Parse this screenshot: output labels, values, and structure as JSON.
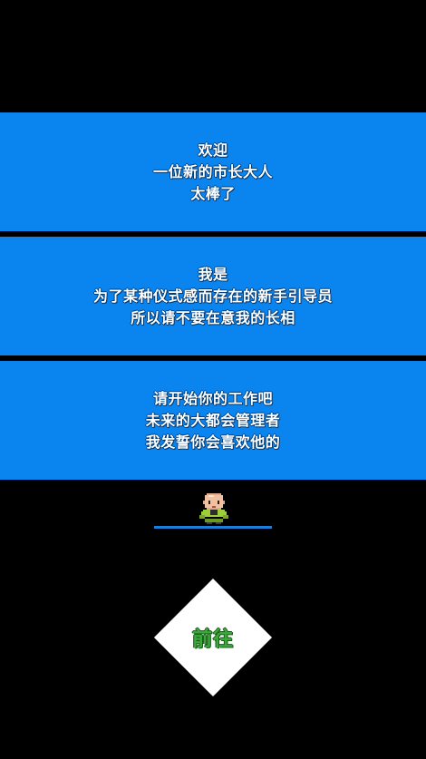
{
  "dialog": {
    "panels": [
      {
        "lines": [
          "欢迎",
          "一位新的市长大人",
          "太棒了"
        ]
      },
      {
        "lines": [
          "我是",
          "为了某种仪式感而存在的新手引导员",
          "所以请不要在意我的长相"
        ]
      },
      {
        "lines": [
          "请开始你的工作吧",
          "未来的大都会管理者",
          "我发誓你会喜欢他的"
        ]
      }
    ]
  },
  "guide": {
    "sprite_icon": "pixel-bald-guide-character"
  },
  "go_button": {
    "label": "前往"
  },
  "colors": {
    "background": "#000000",
    "panel": "#0a85f0",
    "text": "#ffffff",
    "button_fill": "#ffffff",
    "button_text": "#3aa83a",
    "underline": "#1a7fd8"
  }
}
